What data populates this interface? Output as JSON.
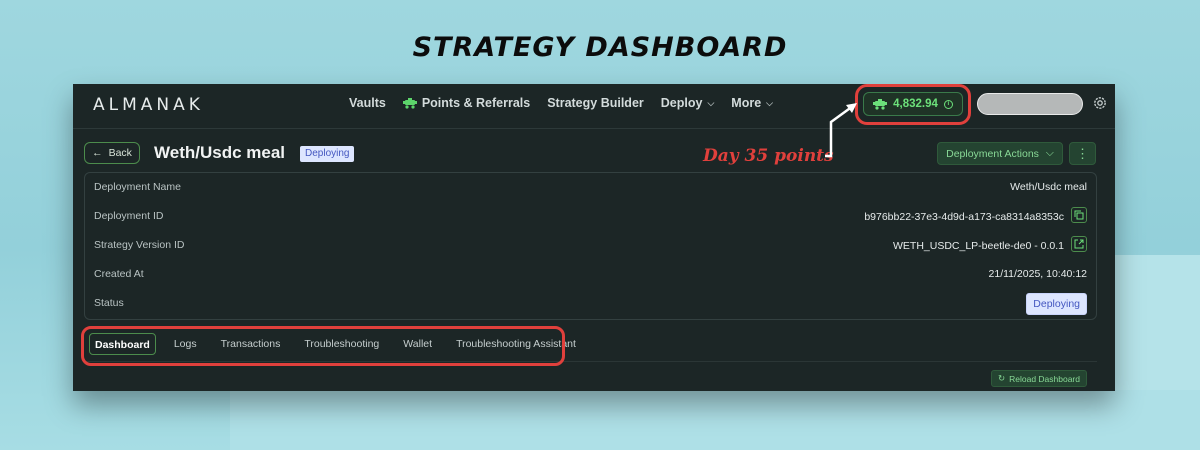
{
  "page_heading": "STRATEGY DASHBOARD",
  "header": {
    "logo": "ALMANAK",
    "nav": [
      {
        "label": "Vaults",
        "icon": ""
      },
      {
        "label": "Points & Referrals",
        "icon": "rover-icon"
      },
      {
        "label": "Strategy Builder",
        "icon": ""
      },
      {
        "label": "Deploy",
        "icon": "chevron-down-icon"
      },
      {
        "label": "More",
        "icon": "chevron-down-icon"
      }
    ],
    "points": "4,832.94"
  },
  "annotation": "Day 35 points",
  "deployment": {
    "back_label": "Back",
    "title": "Weth/Usdc meal",
    "status_chip": "Deploying",
    "actions_label": "Deployment Actions",
    "more_label": "⋮"
  },
  "details": [
    {
      "label": "Deployment Name",
      "value": "Weth/Usdc meal"
    },
    {
      "label": "Deployment ID",
      "value": "b976bb22-37e3-4d9d-a173-ca8314a8353c",
      "icon": "copy-icon"
    },
    {
      "label": "Strategy Version ID",
      "value": "WETH_USDC_LP-beetle-de0 - 0.0.1",
      "icon": "external-link-icon"
    },
    {
      "label": "Created At",
      "value": "21/11/2025, 10:40:12"
    },
    {
      "label": "Status",
      "value": "Deploying"
    }
  ],
  "tabs": [
    {
      "label": "Dashboard",
      "active": true
    },
    {
      "label": "Logs",
      "active": false
    },
    {
      "label": "Transactions",
      "active": false
    },
    {
      "label": "Troubleshooting",
      "active": false
    },
    {
      "label": "Wallet",
      "active": false
    },
    {
      "label": "Troubleshooting Assistant",
      "active": false
    }
  ],
  "reload_label": "Reload Dashboard",
  "colors": {
    "app_bg": "#1c2626",
    "accent_green": "#6ce07a",
    "highlight_red": "#e0403c",
    "status_blue_bg": "#dde6ff",
    "page_bg": "#9fd7df"
  }
}
